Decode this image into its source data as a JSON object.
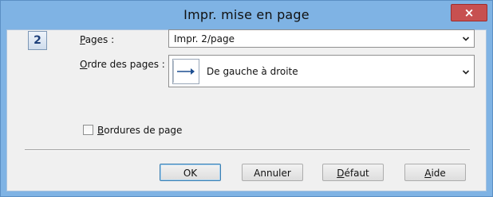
{
  "window": {
    "title": "Impr. mise en page",
    "close_label": "×"
  },
  "page_icon_label": "2",
  "pages": {
    "label_access": "P",
    "label_rest": "ages :",
    "value": "Impr. 2/page"
  },
  "order": {
    "label_access": "O",
    "label_rest": "rdre des pages :",
    "value": "De gauche à droite"
  },
  "borders": {
    "label_access": "B",
    "label_rest": "ordures de page",
    "checked": false
  },
  "buttons": {
    "ok": "OK",
    "cancel": "Annuler",
    "default_access": "D",
    "default_rest": "éfaut",
    "help_access": "A",
    "help_rest": "ide"
  },
  "icons": {
    "close": "close-icon",
    "chevron": "chevron-down-icon",
    "order": "arrow-right-icon",
    "pages": "page-count-icon"
  },
  "colors": {
    "frame": "#7fb3e4",
    "close": "#c75050",
    "client": "#f0f0f0",
    "accent": "#1d4f91"
  }
}
